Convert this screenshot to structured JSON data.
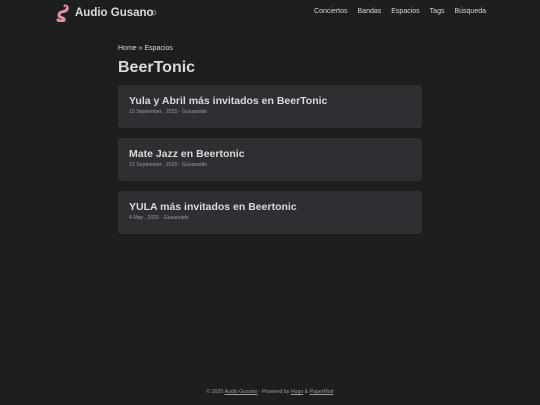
{
  "header": {
    "site_title": "Audio Gusano",
    "theme_toggle_glyph": "☼",
    "nav": [
      "Conciertos",
      "Bandas",
      "Espacios",
      "Tags",
      "Búsqueda"
    ]
  },
  "breadcrumb": {
    "home": "Home",
    "separator": " » ",
    "section": "Espacios"
  },
  "page_title": "BeerTonic",
  "posts": [
    {
      "title": "Yula y Abril más invitados en BeerTonic",
      "meta": "15 September , 2025 · Gusanoide"
    },
    {
      "title": "Mate Jazz en Beertonic",
      "meta": "12 September , 2025 · Gusanoide"
    },
    {
      "title": "YULA más invitados en Beertonic",
      "meta": "4 May , 2025 · Gusanoide"
    }
  ],
  "footer": {
    "prefix": "© 2025 ",
    "site_link": "Audio Gusano",
    "powered": " · Powered by ",
    "hugo": "Hugo",
    "amp": " & ",
    "papermod": "PaperMod"
  },
  "colors": {
    "background": "#1d1e20",
    "card": "#2e2e33",
    "primary_text": "#dadadb",
    "secondary_text": "#9b9c9d",
    "logo_worm": "#e88fa6"
  },
  "icons": {
    "logo": "worm-logo-icon",
    "theme_toggle": "sun-icon"
  }
}
